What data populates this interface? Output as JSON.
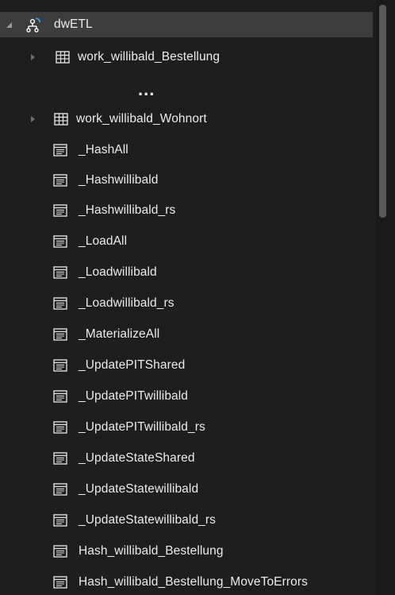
{
  "tree": {
    "root": {
      "label": "dwETL",
      "icon": "database-schema-icon",
      "expanded": true
    },
    "items": [
      {
        "label": "work_willibald_Bestellung",
        "icon": "table-icon",
        "expandable": true
      },
      {
        "label": "work_willibald_Wohnort",
        "icon": "table-icon",
        "expandable": true
      },
      {
        "label": "_HashAll",
        "icon": "stored-procedure-icon",
        "expandable": false
      },
      {
        "label": "_Hashwillibald",
        "icon": "stored-procedure-icon",
        "expandable": false
      },
      {
        "label": "_Hashwillibald_rs",
        "icon": "stored-procedure-icon",
        "expandable": false
      },
      {
        "label": "_LoadAll",
        "icon": "stored-procedure-icon",
        "expandable": false
      },
      {
        "label": "_Loadwillibald",
        "icon": "stored-procedure-icon",
        "expandable": false
      },
      {
        "label": "_Loadwillibald_rs",
        "icon": "stored-procedure-icon",
        "expandable": false
      },
      {
        "label": "_MaterializeAll",
        "icon": "stored-procedure-icon",
        "expandable": false
      },
      {
        "label": "_UpdatePITShared",
        "icon": "stored-procedure-icon",
        "expandable": false
      },
      {
        "label": "_UpdatePITwillibald",
        "icon": "stored-procedure-icon",
        "expandable": false
      },
      {
        "label": "_UpdatePITwillibald_rs",
        "icon": "stored-procedure-icon",
        "expandable": false
      },
      {
        "label": "_UpdateStateShared",
        "icon": "stored-procedure-icon",
        "expandable": false
      },
      {
        "label": "_UpdateStatewillibald",
        "icon": "stored-procedure-icon",
        "expandable": false
      },
      {
        "label": "_UpdateStatewillibald_rs",
        "icon": "stored-procedure-icon",
        "expandable": false
      },
      {
        "label": "Hash_willibald_Bestellung",
        "icon": "stored-procedure-icon",
        "expandable": false
      },
      {
        "label": "Hash_willibald_Bestellung_MoveToErrors",
        "icon": "stored-procedure-icon",
        "expandable": false
      }
    ],
    "ellipsis": "..."
  },
  "colors": {
    "background": "#1e1e1e",
    "selected_row": "#3d3d3d",
    "accent_blue": "#4aa3e8",
    "text": "#ececec"
  }
}
